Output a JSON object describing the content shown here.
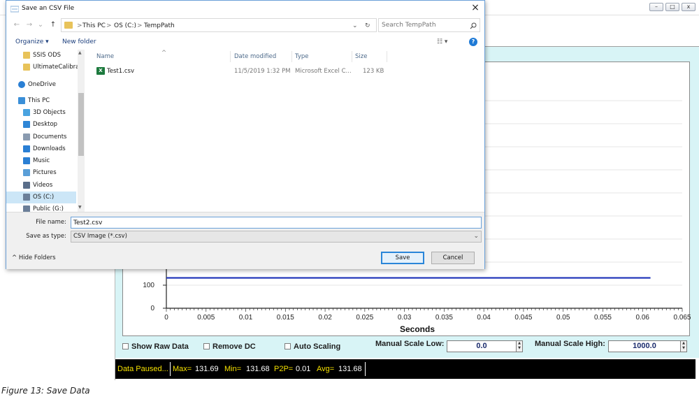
{
  "app": {
    "window_controls": {
      "minimize": "–",
      "maximize": "□",
      "close": "x"
    }
  },
  "dialog": {
    "title": "Save an CSV File",
    "close_glyph": "×",
    "nav_buttons": {
      "back": "←",
      "forward": "→",
      "dropdown": "⌄",
      "up": "↑"
    },
    "address": {
      "crumbs": [
        "This PC",
        "OS (C:)",
        "TempPath"
      ],
      "separator": ">",
      "dropdown_glyph": "⌄",
      "refresh_glyph": "↻"
    },
    "search": {
      "placeholder": "Search TempPath"
    },
    "toolbar": {
      "organize": "Organize ▾",
      "new_folder": "New folder",
      "view_glyph": "☷ ▾",
      "help": "?"
    },
    "nav_pane": [
      {
        "label": "SSIS ODS",
        "icon": "folder-icon",
        "indent": 1
      },
      {
        "label": "UltimateCalibrat",
        "icon": "folder-icon",
        "indent": 1
      },
      {
        "label": "OneDrive",
        "icon": "cloud-icon",
        "indent": 0
      },
      {
        "label": "This PC",
        "icon": "computer-icon",
        "indent": 0
      },
      {
        "label": "3D Objects",
        "icon": "cube-icon",
        "indent": 1
      },
      {
        "label": "Desktop",
        "icon": "desktop-icon",
        "indent": 1
      },
      {
        "label": "Documents",
        "icon": "document-icon",
        "indent": 1
      },
      {
        "label": "Downloads",
        "icon": "download-icon",
        "indent": 1
      },
      {
        "label": "Music",
        "icon": "music-icon",
        "indent": 1
      },
      {
        "label": "Pictures",
        "icon": "picture-icon",
        "indent": 1
      },
      {
        "label": "Videos",
        "icon": "video-icon",
        "indent": 1
      },
      {
        "label": "OS (C:)",
        "icon": "drive-icon",
        "indent": 1,
        "selected": true
      },
      {
        "label": "Public (G:)",
        "icon": "network-drive-icon",
        "indent": 1
      }
    ],
    "columns": {
      "name": "Name",
      "date": "Date modified",
      "type": "Type",
      "size": "Size"
    },
    "files": [
      {
        "name": "Test1.csv",
        "date": "11/5/2019 1:32 PM",
        "type": "Microsoft Excel C...",
        "size": "123 KB"
      }
    ],
    "file_name_label": "File name:",
    "file_name_value": "Test2.csv",
    "save_type_label": "Save as type:",
    "save_type_value": "CSV Image (*.csv)",
    "hide_folders": "Hide Folders",
    "save_button": "Save",
    "cancel_button": "Cancel"
  },
  "controls": {
    "show_raw_data": "Show Raw Data",
    "remove_dc": "Remove DC",
    "auto_scaling": "Auto Scaling",
    "manual_scale_low_label": "Manual Scale Low:",
    "manual_scale_low_value": "0.0",
    "manual_scale_high_label": "Manual Scale High:",
    "manual_scale_high_value": "1000.0"
  },
  "status": {
    "state": "Data Paused...",
    "max_label": "Max=",
    "max_value": "131.69",
    "min_label": "Min=",
    "min_value": "131.68",
    "p2p_label": "P2P=",
    "p2p_value": "0.01",
    "avg_label": "Avg=",
    "avg_value": "131.68"
  },
  "caption": "Figure 13: Save Data",
  "colors": {
    "trace": "#1a2fb8",
    "plot_frame": "#d8f4f6",
    "status_yellow": "#f5e000",
    "accent": "#2a86d9"
  },
  "chart_data": {
    "type": "line",
    "xlabel": "Seconds",
    "x_ticks": [
      "0",
      "0.005",
      "0.01",
      "0.015",
      "0.02",
      "0.025",
      "0.03",
      "0.035",
      "0.04",
      "0.045",
      "0.05",
      "0.055",
      "0.06",
      "0.065"
    ],
    "y_ticks": [
      "0",
      "100"
    ],
    "xlim": [
      0,
      0.065
    ],
    "series": [
      {
        "x": [
          0,
          0.061
        ],
        "y": [
          131.68,
          131.68
        ]
      }
    ]
  }
}
